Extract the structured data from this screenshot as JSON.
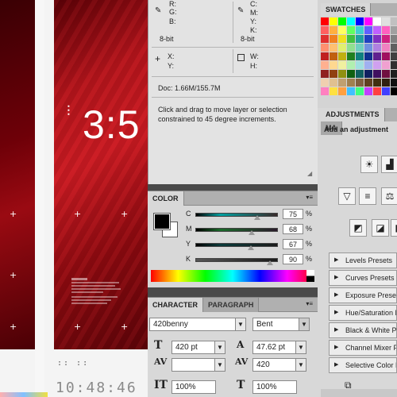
{
  "info": {
    "rgb_labels": [
      "R:",
      "G:",
      "B:"
    ],
    "cmyk_labels": [
      "C:",
      "M:",
      "Y:",
      "K:"
    ],
    "bitdepth_left": "8-bit",
    "bitdepth_right": "8-bit",
    "xy_labels": [
      "X:",
      "Y:"
    ],
    "wh_labels": [
      "W:",
      "H:"
    ],
    "doc": "Doc: 1.66M/155.7M",
    "hint": "Click and drag to move layer or selection constrained to 45 degree increments."
  },
  "color_panel": {
    "tab": "COLOR",
    "channels": [
      {
        "label": "C",
        "value": "75",
        "unit": "%",
        "level": 0.75
      },
      {
        "label": "M",
        "value": "68",
        "unit": "%",
        "level": 0.68
      },
      {
        "label": "Y",
        "value": "67",
        "unit": "%",
        "level": 0.67
      },
      {
        "label": "K",
        "value": "90",
        "unit": "%",
        "level": 0.9
      }
    ],
    "foreground": "#000000",
    "background": "#ffffff"
  },
  "character_panel": {
    "tabs": [
      "CHARACTER",
      "PARAGRAPH"
    ],
    "font_family": "420benny",
    "font_style": "Bent",
    "font_size": "420 pt",
    "leading": "47.62 pt",
    "kerning": "",
    "tracking": "420",
    "vertical_scale": "100%",
    "horizontal_scale": "100%"
  },
  "swatches": {
    "tab": "SWATCHES"
  },
  "adjustments": {
    "tabs": [
      "ADJUSTMENTS",
      "MA"
    ],
    "header": "Add an adjustment",
    "presets": [
      "Levels Presets",
      "Curves Presets",
      "Exposure Presets",
      "Hue/Saturation Presets",
      "Black & White Presets",
      "Channel Mixer Presets",
      "Selective Color Presets"
    ]
  },
  "canvas": {
    "big_time": "3:5",
    "small_time": "10:48:46",
    "dots": "::  ::"
  }
}
